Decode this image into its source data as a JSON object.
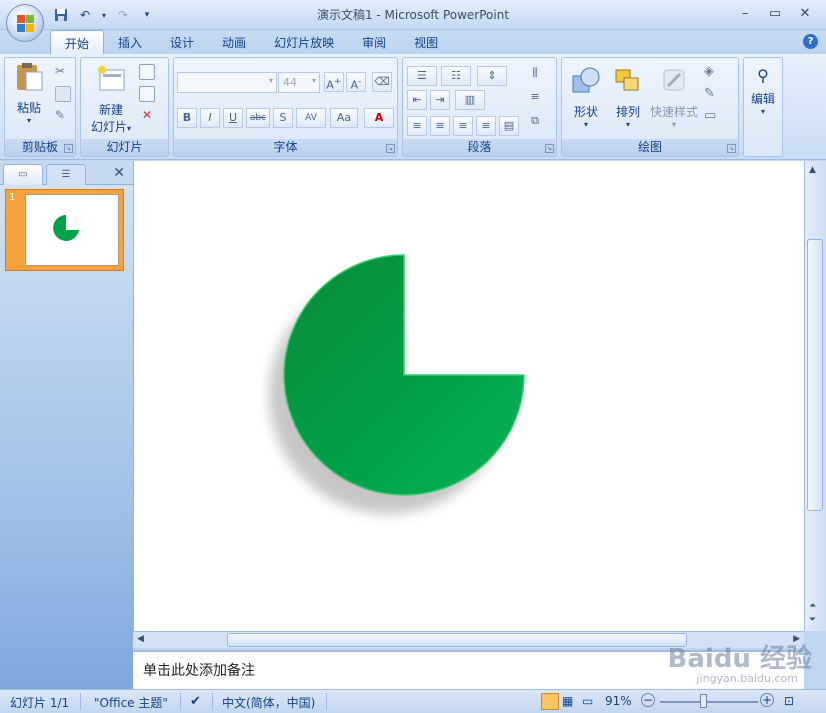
{
  "window": {
    "title": "演示文稿1 - Microsoft PowerPoint"
  },
  "tabs": [
    "开始",
    "插入",
    "设计",
    "动画",
    "幻灯片放映",
    "审阅",
    "视图"
  ],
  "ribbon": {
    "clipboard": {
      "paste": "粘贴",
      "group_label": "剪贴板"
    },
    "slides": {
      "new_slide_line1": "新建",
      "new_slide_line2": "幻灯片",
      "group_label": "幻灯片"
    },
    "font": {
      "font_name": "",
      "font_size": "44",
      "group_label": "字体",
      "bold": "B",
      "italic": "I",
      "underline": "U",
      "strike": "abc",
      "shadow": "S",
      "spacing": "AV",
      "case": "Aa",
      "color": "A"
    },
    "paragraph": {
      "group_label": "段落"
    },
    "drawing": {
      "shapes": "形状",
      "arrange": "排列",
      "quick_styles": "快速样式",
      "group_label": "绘图"
    },
    "editing": {
      "label": "编辑"
    }
  },
  "slide_pane": {
    "slide_number": "1"
  },
  "notes": {
    "placeholder": "单击此处添加备注"
  },
  "status": {
    "slide": "幻灯片 1/1",
    "theme": "\"Office 主题\"",
    "language": "中文(简体，中国)",
    "zoom": "91%"
  },
  "watermark": {
    "text": "Baidu 经验",
    "sub": "jingyan.baidu.com"
  },
  "colors": {
    "accent": "#00a24a",
    "selected_slide": "#f6a33d"
  }
}
